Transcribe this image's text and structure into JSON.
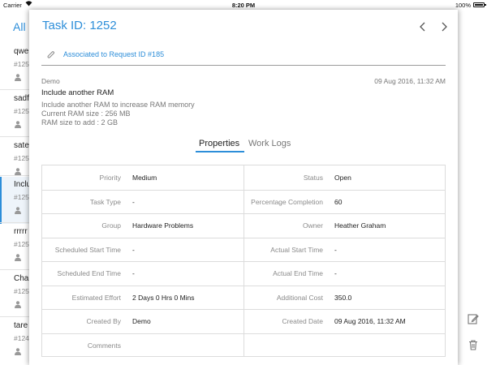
{
  "status_bar": {
    "carrier": "Carrier",
    "time": "8:20 PM",
    "battery": "100%"
  },
  "background_list": {
    "header": "All",
    "items": [
      {
        "title": "qwe",
        "id": "#125"
      },
      {
        "title": "sadf",
        "id": "#125"
      },
      {
        "title": "sate",
        "id": "#125"
      },
      {
        "title": "Inclu",
        "id": "#125",
        "selected": true
      },
      {
        "title": "rrrrr",
        "id": "#125"
      },
      {
        "title": "Cha",
        "id": "#125"
      },
      {
        "title": "tare",
        "id": "#124"
      }
    ]
  },
  "task": {
    "title": "Task ID: 1252",
    "association": "Associated to Request ID #185",
    "author": "Demo",
    "date": "09 Aug 2016, 11:32 AM",
    "request_title": "Include another RAM",
    "description": [
      "Include another RAM to increase RAM memory",
      "Current RAM size : 256 MB",
      "RAM size to add : 2 GB"
    ]
  },
  "tabs": {
    "properties": "Properties",
    "work_logs": "Work Logs"
  },
  "properties": [
    {
      "left_label": "Priority",
      "left_value": "Medium",
      "right_label": "Status",
      "right_value": "Open"
    },
    {
      "left_label": "Task Type",
      "left_value": "-",
      "right_label": "Percentage Completion",
      "right_value": "60"
    },
    {
      "left_label": "Group",
      "left_value": "Hardware Problems",
      "right_label": "Owner",
      "right_value": "Heather Graham"
    },
    {
      "left_label": "Scheduled Start Time",
      "left_value": "-",
      "right_label": "Actual Start Time",
      "right_value": "-"
    },
    {
      "left_label": "Scheduled End Time",
      "left_value": "-",
      "right_label": "Actual End Time",
      "right_value": "-"
    },
    {
      "left_label": "Estimated Effort",
      "left_value": "2 Days 0 Hrs 0 Mins",
      "right_label": "Additional Cost",
      "right_value": "350.0"
    },
    {
      "left_label": "Created By",
      "left_value": "Demo",
      "right_label": "Created Date",
      "right_value": "09 Aug 2016, 11:32 AM"
    },
    {
      "left_label": "Comments",
      "left_value": "",
      "right_label": "",
      "right_value": ""
    }
  ],
  "icons": {
    "prev": "chevron-left-icon",
    "next": "chevron-right-icon",
    "attachment": "paperclip-icon",
    "edit": "edit-icon",
    "delete": "trash-icon",
    "user": "user-icon"
  },
  "colors": {
    "accent": "#2d8ed9",
    "muted": "#8a8a8a",
    "border": "#dcdcdc"
  }
}
